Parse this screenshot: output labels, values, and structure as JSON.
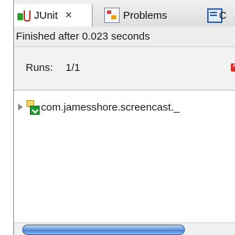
{
  "tabs": [
    {
      "label": "JUnit",
      "close_glyph": "✕",
      "icon": "junit-icon",
      "active": true
    },
    {
      "label": "Problems",
      "icon": "problems-icon",
      "active": false
    },
    {
      "label": "C",
      "icon": "console-icon",
      "active": false
    }
  ],
  "status": {
    "text": "Finished after 0.023 seconds"
  },
  "counters": {
    "runs_label": "Runs:",
    "runs_value": "1/1"
  },
  "tree": {
    "items": [
      {
        "label": "com.jamesshore.screencast._",
        "icon": "test-suite-icon",
        "expanded": false
      }
    ]
  },
  "colors": {
    "pass_green": "#28a02a",
    "fail_red": "#e02a2a",
    "scroll_thumb": "#4a82d4"
  }
}
